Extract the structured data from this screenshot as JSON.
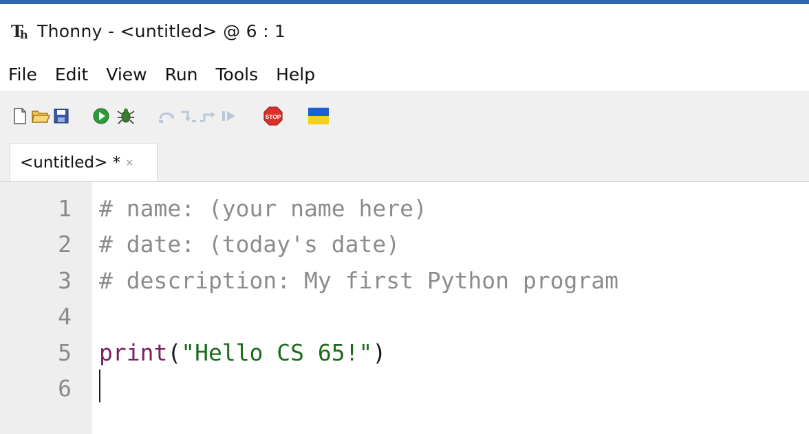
{
  "window": {
    "title": "Thonny  -  <untitled>  @  6 : 1",
    "accent_color": "#2f66b0"
  },
  "menu": [
    "File",
    "Edit",
    "View",
    "Run",
    "Tools",
    "Help"
  ],
  "toolbar": {
    "icons": [
      "new-file-icon",
      "open-file-icon",
      "save-icon",
      "run-icon",
      "debug-icon",
      "step-over-icon",
      "step-into-icon",
      "step-out-icon",
      "resume-icon",
      "stop-icon",
      "ukraine-flag-icon"
    ]
  },
  "tab": {
    "label": "<untitled> *",
    "close": "×"
  },
  "editor": {
    "lines": [
      {
        "number": "1",
        "text": "# name: (your name here)"
      },
      {
        "number": "2",
        "text": "# date: (today's date)"
      },
      {
        "number": "3",
        "text": "# description: My first Python program"
      },
      {
        "number": "4",
        "text": ""
      },
      {
        "number": "5",
        "func": "print",
        "open": "(",
        "string": "\"Hello CS 65!\"",
        "close": ")"
      },
      {
        "number": "6",
        "text": ""
      }
    ],
    "colors": {
      "comment": "#8c8c8c",
      "builtin": "#7a1f5f",
      "string": "#1d6b1d",
      "line_number": "#8a8a8a",
      "gutter": "#eeeeee"
    }
  }
}
